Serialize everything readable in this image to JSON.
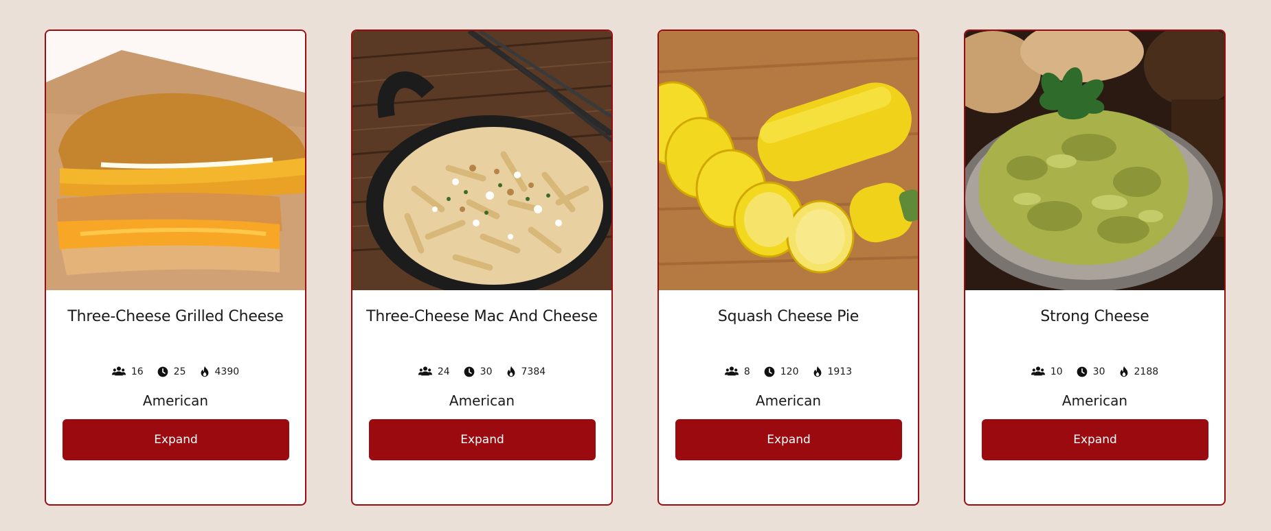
{
  "theme": {
    "page_background": "#ebe0d7",
    "card_border": "#9b0a0f",
    "button_background": "#9b0a0f",
    "button_text": "#ffffff"
  },
  "icons": {
    "servings": "people-icon",
    "time": "clock-icon",
    "calories": "flame-icon"
  },
  "recipes": [
    {
      "title": "Three-Cheese Grilled Cheese",
      "servings": "16",
      "time": "25",
      "calories": "4390",
      "cuisine": "American",
      "button_label": "Expand",
      "image": "grilled-cheese-sandwich"
    },
    {
      "title": "Three-Cheese Mac And Cheese",
      "servings": "24",
      "time": "30",
      "calories": "7384",
      "cuisine": "American",
      "button_label": "Expand",
      "image": "penne-skillet"
    },
    {
      "title": "Squash Cheese Pie",
      "servings": "8",
      "time": "120",
      "calories": "1913",
      "cuisine": "American",
      "button_label": "Expand",
      "image": "yellow-squash"
    },
    {
      "title": "Strong Cheese",
      "servings": "10",
      "time": "30",
      "calories": "2188",
      "cuisine": "American",
      "button_label": "Expand",
      "image": "green-cheese-spread"
    }
  ]
}
